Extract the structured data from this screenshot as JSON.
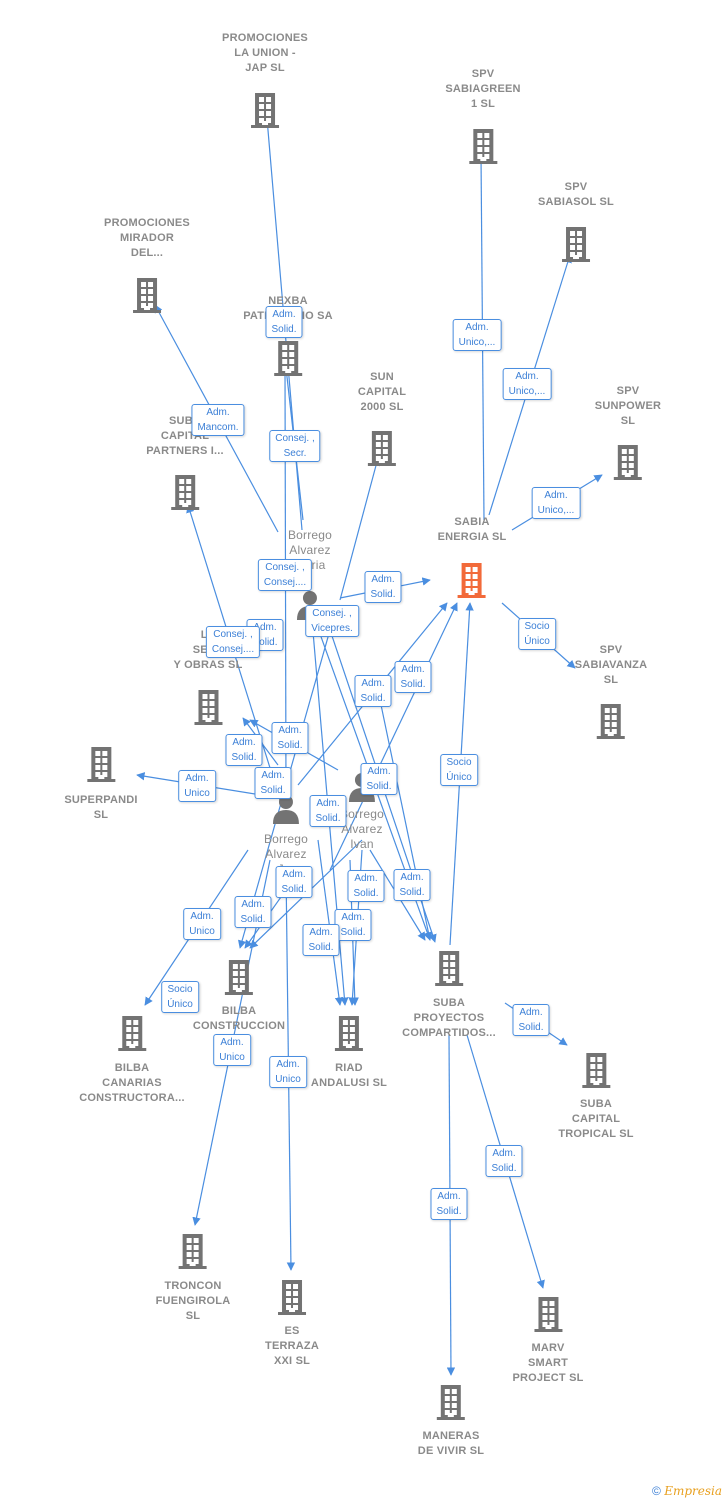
{
  "colors": {
    "edge": "#4a8ee0",
    "company": "#737373",
    "main_company": "#f26a3a",
    "text": "#8a8a8a"
  },
  "nodes": [
    {
      "id": "promociones_la_union",
      "type": "company",
      "label": [
        "PROMOCIONES",
        "LA UNION -",
        "JAP  SL"
      ]
    },
    {
      "id": "spv_sabiagreen",
      "type": "company",
      "label": [
        "SPV",
        "SABIAGREEN",
        "1  SL"
      ]
    },
    {
      "id": "spv_sabiasol",
      "type": "company",
      "label": [
        "SPV",
        "SABIASOL  SL"
      ]
    },
    {
      "id": "promociones_mirador",
      "type": "company",
      "label": [
        "PROMOCIONES",
        "MIRADOR",
        "DEL..."
      ]
    },
    {
      "id": "nexba",
      "type": "company",
      "label": [
        "NEXBA",
        "PATRIMONIO SA"
      ]
    },
    {
      "id": "sun_capital_2000",
      "type": "company",
      "label": [
        "SUN",
        "CAPITAL",
        "2000  SL"
      ]
    },
    {
      "id": "spv_sunpower",
      "type": "company",
      "label": [
        "SPV",
        "SUNPOWER",
        "SL"
      ]
    },
    {
      "id": "suba_capital_partners",
      "type": "company",
      "label": [
        "SUBA",
        "CAPITAL",
        "PARTNERS I..."
      ]
    },
    {
      "id": "sabia_energia",
      "type": "main",
      "label": [
        "SABIA",
        "ENERGIA  SL"
      ]
    },
    {
      "id": "borrego_maria",
      "type": "person",
      "label": [
        "Borrego",
        "Alvarez",
        "Maria"
      ]
    },
    {
      "id": "le_servicios_obras",
      "type": "company",
      "label": [
        "LE",
        "SERV",
        "Y OBRAS  SL"
      ]
    },
    {
      "id": "spv_sabiavanza",
      "type": "company",
      "label": [
        "SPV",
        "SABIAVANZA",
        "SL"
      ]
    },
    {
      "id": "superpandi",
      "type": "company",
      "label": [
        "SUPERPANDI",
        "SL"
      ]
    },
    {
      "id": "borrego_j",
      "type": "person",
      "label": [
        "Borrego",
        "Alvarez",
        "J..."
      ]
    },
    {
      "id": "borrego_ivan",
      "type": "person",
      "label": [
        "Borrego",
        "Alvarez",
        "Ivan"
      ]
    },
    {
      "id": "bilba_construccion",
      "type": "company",
      "label": [
        "BILBA",
        "CONSTRUCCION"
      ]
    },
    {
      "id": "bilba_canarias",
      "type": "company",
      "label": [
        "BILBA",
        "CANARIAS",
        "CONSTRUCTORA..."
      ]
    },
    {
      "id": "riad_andalusi",
      "type": "company",
      "label": [
        "RIAD",
        "ANDALUSI  SL"
      ]
    },
    {
      "id": "suba_proyectos",
      "type": "company",
      "label": [
        "SUBA",
        "PROYECTOS",
        "COMPARTIDOS..."
      ]
    },
    {
      "id": "suba_capital_tropical",
      "type": "company",
      "label": [
        "SUBA",
        "CAPITAL",
        "TROPICAL  SL"
      ]
    },
    {
      "id": "troncon_fuengirola",
      "type": "company",
      "label": [
        "TRONCON",
        "FUENGIROLA",
        "SL"
      ]
    },
    {
      "id": "es_terraza",
      "type": "company",
      "label": [
        "ES",
        "TERRAZA",
        "XXI SL"
      ]
    },
    {
      "id": "marv_smart",
      "type": "company",
      "label": [
        "MARV",
        "SMART",
        "PROJECT  SL"
      ]
    },
    {
      "id": "maneras_de_vivir",
      "type": "company",
      "label": [
        "MANERAS",
        "DE VIVIR  SL"
      ]
    }
  ],
  "edge_labels": [
    [
      "Adm.",
      "Solid."
    ],
    [
      "Adm.",
      "Unico,..."
    ],
    [
      "Adm.",
      "Unico,..."
    ],
    [
      "Adm.",
      "Mancom."
    ],
    [
      "Consej. ,",
      "Secr."
    ],
    [
      "Adm.",
      "Unico,..."
    ],
    [
      "Consej. ,",
      "Consej...."
    ],
    [
      "Adm.",
      "Solid."
    ],
    [
      "Consej. ,",
      "Vicepres."
    ],
    [
      "Adm.",
      "Solid."
    ],
    [
      "Consej. ,",
      "Consej...."
    ],
    [
      "Socio",
      "Único"
    ],
    [
      "Adm.",
      "Solid."
    ],
    [
      "Adm.",
      "Solid."
    ],
    [
      "Adm.",
      "Solid."
    ],
    [
      "Adm.",
      "Solid."
    ],
    [
      "Adm.",
      "Unico"
    ],
    [
      "Adm.",
      "Solid."
    ],
    [
      "Adm.",
      "Solid."
    ],
    [
      "Socio",
      "Único"
    ],
    [
      "Adm.",
      "Solid."
    ],
    [
      "Adm.",
      "Solid."
    ],
    [
      "Adm.",
      "Solid."
    ],
    [
      "Adm.",
      "Solid."
    ],
    [
      "Adm.",
      "Solid."
    ],
    [
      "Adm.",
      "Unico"
    ],
    [
      "Adm.",
      "Solid."
    ],
    [
      "Adm.",
      "Solid."
    ],
    [
      "Socio",
      "Único"
    ],
    [
      "Adm.",
      "Solid."
    ],
    [
      "Adm.",
      "Unico"
    ],
    [
      "Adm.",
      "Unico"
    ],
    [
      "Adm.",
      "Solid."
    ],
    [
      "Adm.",
      "Solid."
    ]
  ],
  "footer": {
    "copyright": "©",
    "brand": "Empresia"
  }
}
